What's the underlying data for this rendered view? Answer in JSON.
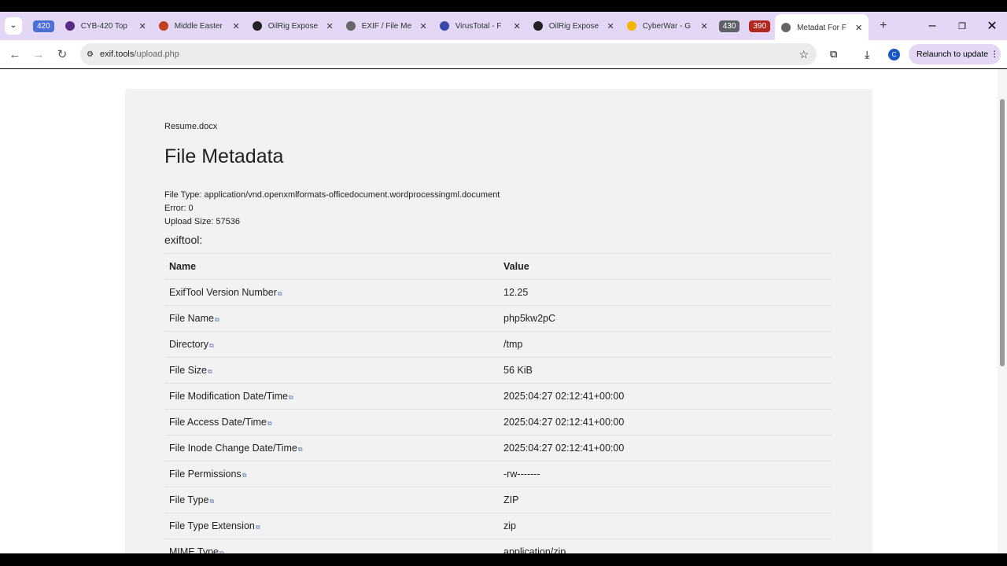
{
  "browser": {
    "group_badges": [
      {
        "label": "420",
        "color": "#4a6fd6"
      },
      {
        "label": "430",
        "color": "#5f6368"
      },
      {
        "label": "390",
        "color": "#b3261e"
      }
    ],
    "tabs": [
      {
        "title": "CYB-420 Top",
        "icon": "hat-icon",
        "color": "#5b2a86"
      },
      {
        "title": "Middle Easter",
        "icon": "powerpoint-icon",
        "color": "#c43e1c"
      },
      {
        "title": "OilRig Expose",
        "icon": "v-logo-icon",
        "color": "#222"
      },
      {
        "title": "EXIF / File Me",
        "icon": "globe-icon",
        "color": "#666"
      },
      {
        "title": "VirusTotal - F",
        "icon": "sigma-icon",
        "color": "#3949ab"
      },
      {
        "title": "OilRig Expose",
        "icon": "v-logo-icon",
        "color": "#222"
      },
      {
        "title": "CyberWar - G",
        "icon": "drive-icon",
        "color": "#f4b400"
      },
      {
        "title": "Metadat For F",
        "icon": "globe-icon",
        "color": "#666"
      }
    ],
    "url_host": "exif.tools",
    "url_path": "/upload.php",
    "relaunch": "Relaunch to update",
    "profile": "C"
  },
  "page": {
    "filename": "Resume.docx",
    "title": "File Metadata",
    "info": [
      "File Type: application/vnd.openxmlformats-officedocument.wordprocessingml.document",
      "Error: 0",
      "Upload Size: 57536"
    ],
    "tool": "exiftool:",
    "headers": [
      "Name",
      "Value"
    ],
    "rows": [
      [
        "ExifTool Version Number",
        "12.25"
      ],
      [
        "File Name",
        "php5kw2pC"
      ],
      [
        "Directory",
        "/tmp"
      ],
      [
        "File Size",
        "56 KiB"
      ],
      [
        "File Modification Date/Time",
        "2025:04:27 02:12:41+00:00"
      ],
      [
        "File Access Date/Time",
        "2025:04:27 02:12:41+00:00"
      ],
      [
        "File Inode Change Date/Time",
        "2025:04:27 02:12:41+00:00"
      ],
      [
        "File Permissions",
        "-rw-------"
      ],
      [
        "File Type",
        "ZIP"
      ],
      [
        "File Type Extension",
        "zip"
      ],
      [
        "MIME Type",
        "application/zip"
      ]
    ]
  }
}
